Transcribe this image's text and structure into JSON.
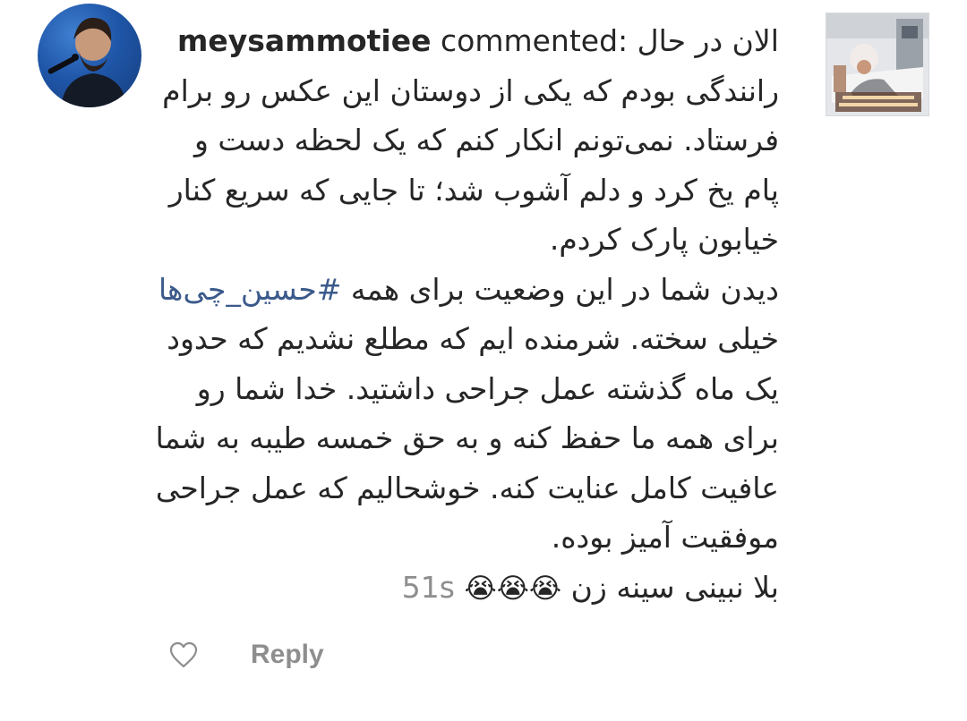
{
  "comment": {
    "username": "meysammotiee",
    "commented_label": "commented:",
    "lines": [
      "الان در حال",
      "رانندگی بودم که یکی از دوستان این عکس رو برام",
      "فرستاد. نمی‌تونم انکار کنم که یک لحظه دست و",
      "پام یخ کرد و دلم آشوب شد؛ تا جایی که سریع کنار",
      "خیابون پارک کردم.",
      "دیدن شما در این وضعیت برای همه",
      "خیلی سخته. شرمنده ایم که مطلع نشدیم که حدود",
      "یک ماه گذشته عمل جراحی داشتید. خدا شما رو",
      "برای همه ما حفظ کنه و به حق خمسه طیبه به شما",
      "عافیت کامل عنایت کنه. خوشحالیم که عمل جراحی",
      "موفقیت آمیز بوده.",
      "بلا نبینی سینه زن"
    ],
    "hashtag": "#حسین_چی‌ها",
    "emoji": "😭😭😭",
    "timestamp": "51s"
  },
  "actions": {
    "reply_label": "Reply"
  },
  "icons": {
    "like": "heart-outline-icon"
  },
  "colors": {
    "text": "#262626",
    "muted": "#8e8e8e",
    "hashtag": "#3b5a8b"
  }
}
